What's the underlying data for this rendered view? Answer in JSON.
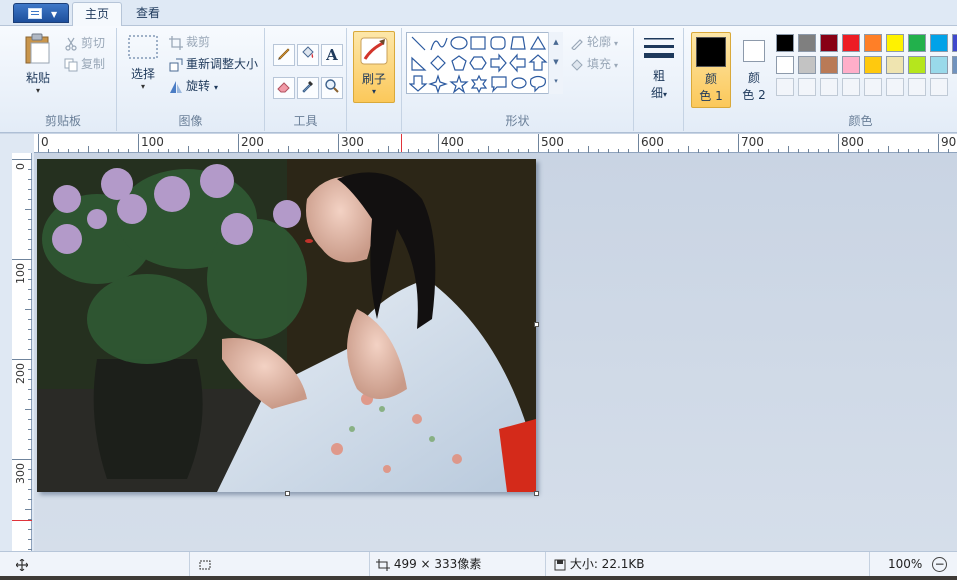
{
  "tabs": {
    "home": "主页",
    "view": "查看"
  },
  "clipboard": {
    "paste": "粘贴",
    "cut": "剪切",
    "copy": "复制",
    "group": "剪贴板"
  },
  "image": {
    "select": "选择",
    "crop": "裁剪",
    "resize": "重新调整大小",
    "rotate": "旋转",
    "group": "图像"
  },
  "tools": {
    "group": "工具"
  },
  "brush": {
    "label": "刷子"
  },
  "shapes": {
    "outline": "轮廓",
    "fill": "填充",
    "group": "形状"
  },
  "size": {
    "line1": "粗",
    "line2": "细"
  },
  "colors": {
    "color1_a": "颜",
    "color1_b": "色 1",
    "color2_a": "颜",
    "color2_b": "色 2",
    "group": "颜色",
    "color1_value": "#000000",
    "color2_value": "#ffffff",
    "palette_row1": [
      "#000000",
      "#7f7f7f",
      "#880015",
      "#ed1c24",
      "#ff7f27",
      "#fff200",
      "#22b14c",
      "#00a2e8",
      "#3f48cc"
    ],
    "palette_row2": [
      "#ffffff",
      "#c3c3c3",
      "#b97a57",
      "#ffaec9",
      "#ffc90e",
      "#efe4b0",
      "#b5e61d",
      "#99d9ea",
      "#7092be"
    ]
  },
  "ruler": {
    "top_labels": [
      "0",
      "100",
      "200",
      "300",
      "400",
      "500",
      "600",
      "700",
      "800",
      "900"
    ],
    "left_labels": [
      "0",
      "100",
      "200",
      "300"
    ]
  },
  "status": {
    "dimensions": "499 × 333像素",
    "filesize": "大小: 22.1KB",
    "zoom": "100%"
  }
}
